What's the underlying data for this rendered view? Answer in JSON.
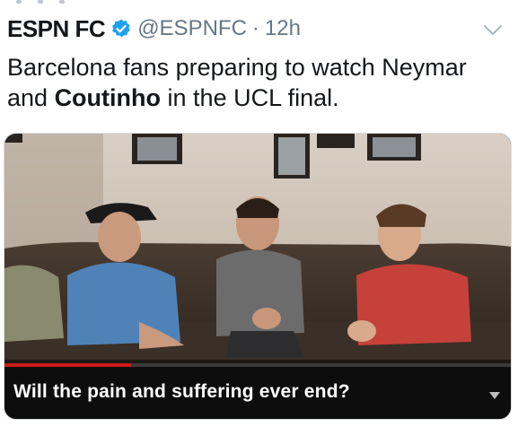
{
  "tweet": {
    "author_name": "ESPN FC",
    "handle": "@ESPNFC",
    "separator": "·",
    "time": "12h",
    "text_part1": "Barcelona fans preparing to watch Neymar and ",
    "text_bold": "Coutinho",
    "text_part2": " in the UCL final.",
    "verified": true
  },
  "media": {
    "caption": "Will the pain and suffering ever end?",
    "playback_progress": 0.25
  },
  "colors": {
    "verified_blue": "#1da1f2",
    "progress_red": "#cc1a1a"
  },
  "icons": {
    "verified": "verified-badge-icon",
    "menu": "chevron-down-icon",
    "caption_menu": "caret-down-icon"
  }
}
